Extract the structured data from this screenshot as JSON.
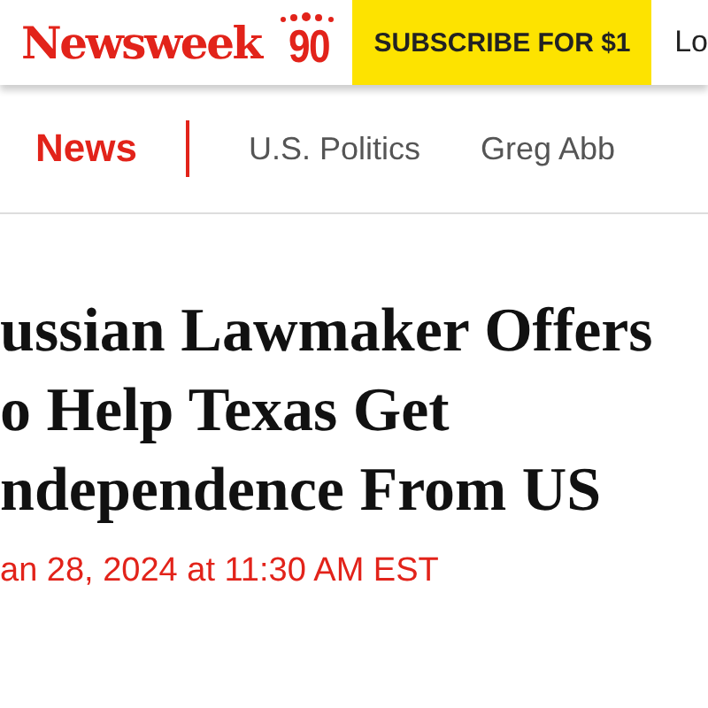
{
  "header": {
    "logo": "Newsweek",
    "anniversary": "90",
    "subscribe": "SUBSCRIBE FOR $1",
    "login": "Lo"
  },
  "nav": {
    "items": [
      {
        "label": "News",
        "selected": true
      },
      {
        "label": "U.S. Politics",
        "selected": false
      },
      {
        "label": "Greg Abb",
        "selected": false
      }
    ]
  },
  "article": {
    "headline_lines": [
      "ussian Lawmaker Offers",
      "o Help Texas Get",
      "ndependence From US"
    ],
    "date": "an 28, 2024 at 11:30 AM EST"
  }
}
